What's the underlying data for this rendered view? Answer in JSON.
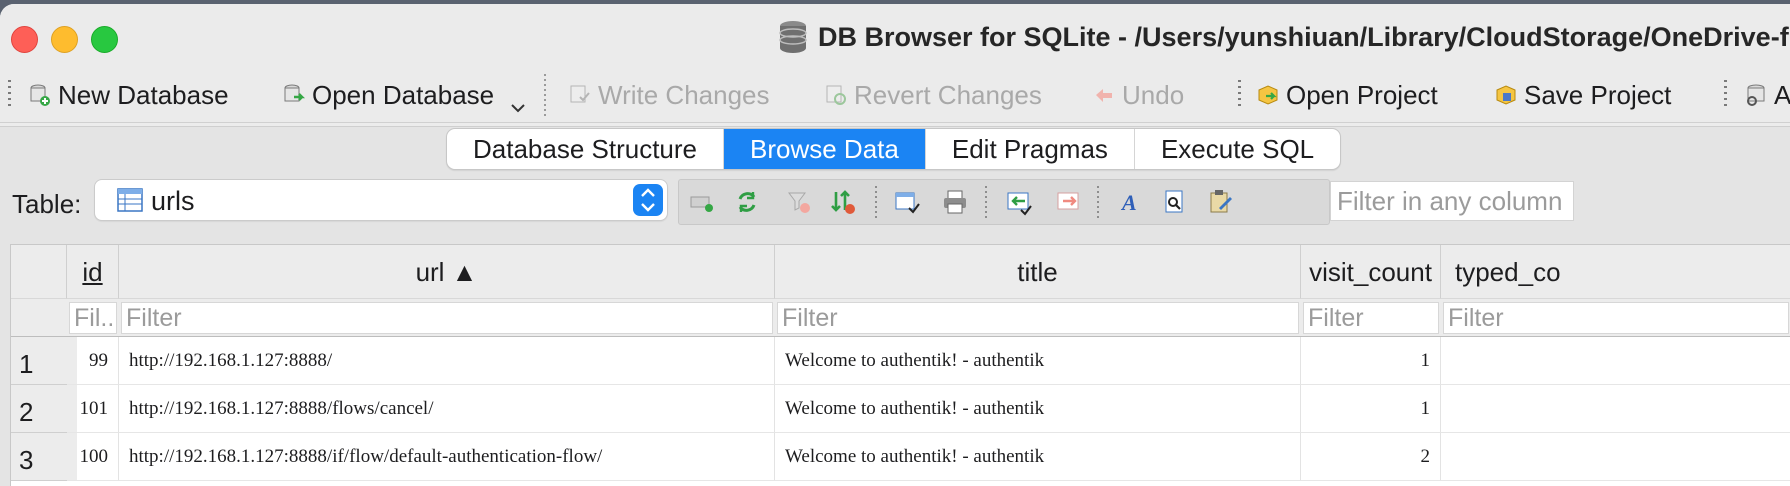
{
  "window": {
    "title": "DB Browser for SQLite - /Users/yunshiuan/Library/CloudStorage/OneDrive-f"
  },
  "toolbar": {
    "new_database": "New Database",
    "open_database": "Open Database",
    "write_changes": "Write Changes",
    "revert_changes": "Revert Changes",
    "undo": "Undo",
    "open_project": "Open Project",
    "save_project": "Save Project",
    "attach_partial": "A"
  },
  "tabs": [
    "Database Structure",
    "Browse Data",
    "Edit Pragmas",
    "Execute SQL"
  ],
  "active_tab": "Browse Data",
  "browse": {
    "table_label": "Table:",
    "table_name": "urls",
    "filter_any_placeholder": "Filter in any column"
  },
  "grid": {
    "columns": [
      "id",
      "url ▲",
      "title",
      "visit_count",
      "typed_co"
    ],
    "filter_placeholders": [
      "Fil...",
      "Filter",
      "Filter",
      "Filter",
      "Filter"
    ],
    "rows": [
      {
        "num": "1",
        "id": "99",
        "url": "http://192.168.1.127:8888/",
        "title": "Welcome to authentik! - authentik",
        "visit_count": "1",
        "typed_count": ""
      },
      {
        "num": "2",
        "id": "101",
        "url": "http://192.168.1.127:8888/flows/cancel/",
        "title": "Welcome to authentik! - authentik",
        "visit_count": "1",
        "typed_count": ""
      },
      {
        "num": "3",
        "id": "100",
        "url": "http://192.168.1.127:8888/if/flow/default-authentication-flow/",
        "title": "Welcome to authentik! - authentik",
        "visit_count": "2",
        "typed_count": ""
      }
    ]
  },
  "colors": {
    "accent": "#1b84f3",
    "close": "#fe5f57",
    "minimize": "#febc2e",
    "maximize": "#28c840"
  }
}
